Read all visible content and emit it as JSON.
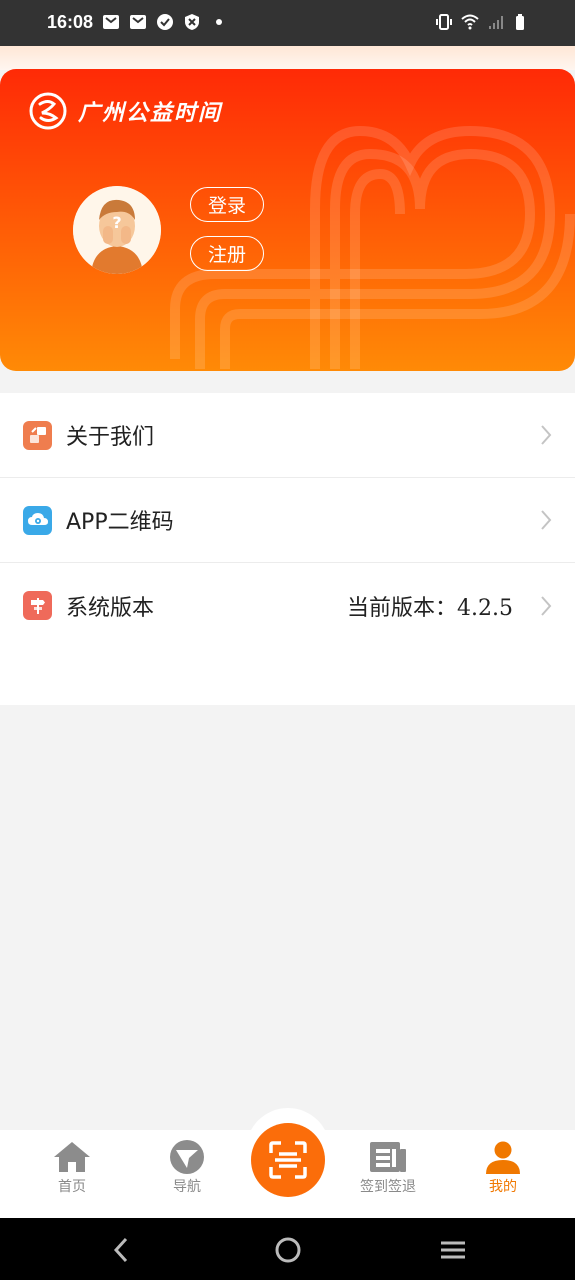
{
  "status_bar": {
    "time": "16:08",
    "left_icons": [
      "mail-icon",
      "mail-icon",
      "check-circle-icon",
      "shield-icon",
      "dot-icon"
    ],
    "right_icons": [
      "vibrate-icon",
      "wifi-icon",
      "signal-icon",
      "battery-icon"
    ]
  },
  "header": {
    "brand_name": "广州公益时间",
    "login_label": "登录",
    "register_label": "注册",
    "gradient_colors": [
      "#ff2a06",
      "#ff8a06"
    ]
  },
  "menu": {
    "items": [
      {
        "label": "关于我们",
        "icon": "about-icon",
        "icon_color": "#ef7d4e"
      },
      {
        "label": "APP二维码",
        "icon": "qr-cloud-icon",
        "icon_color": "#3aa9e8"
      },
      {
        "label": "系统版本",
        "icon": "signpost-icon",
        "icon_color": "#ef6a5a",
        "value": "当前版本：4.2.5"
      }
    ]
  },
  "tab_bar": {
    "tabs": [
      {
        "label": "首页",
        "icon": "home-icon"
      },
      {
        "label": "导航",
        "icon": "navigation-icon"
      },
      {
        "label": "签到签退",
        "icon": "checkin-icon"
      },
      {
        "label": "我的",
        "icon": "profile-icon",
        "active": true
      }
    ],
    "scan_icon": "scan-icon",
    "active_color": "#f07800"
  },
  "system_nav": [
    "back-icon",
    "home-circle-icon",
    "recents-icon"
  ]
}
